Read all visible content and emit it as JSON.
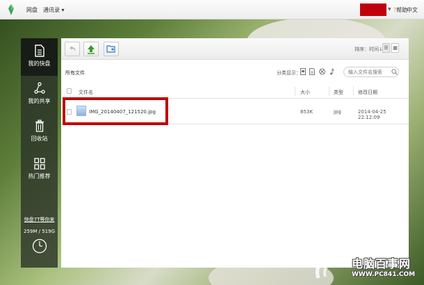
{
  "topbar": {
    "nav": [
      {
        "label": "网盘",
        "icon": "none"
      },
      {
        "label": "通讯录 ▾",
        "icon": "none"
      }
    ],
    "help": "帮助",
    "language": "中文"
  },
  "sidebar": {
    "items": [
      {
        "label": "我的快盘",
        "icon": "document-icon",
        "active": true
      },
      {
        "label": "我的共享",
        "icon": "share-icon",
        "active": false
      },
      {
        "label": "回收站",
        "icon": "trash-icon",
        "active": false
      },
      {
        "label": "热门推荐",
        "icon": "grid-icon",
        "active": false
      }
    ],
    "storage_link": "快盘7T等你来",
    "storage_usage": "259M / 519G"
  },
  "toolbar": {
    "sort_label": "排序：时间"
  },
  "filter": {
    "breadcrumb": "所有文件",
    "category_label": "分类显示：",
    "search_placeholder": "输入文件名搜索"
  },
  "table": {
    "columns": [
      "文件名",
      "大小",
      "类型",
      "修改日期"
    ],
    "rows": [
      {
        "name": "IMG_20140407_121520.jpg",
        "size": "853K",
        "type": "jpg",
        "date": "2014-04-25 22:12:09"
      }
    ]
  },
  "watermark": {
    "site": "电脑百事网",
    "url": "WWW.PC841.COM"
  },
  "colors": {
    "highlight": "#c00000",
    "logo": "#3aa757",
    "sidebar_bg": "#283026"
  }
}
